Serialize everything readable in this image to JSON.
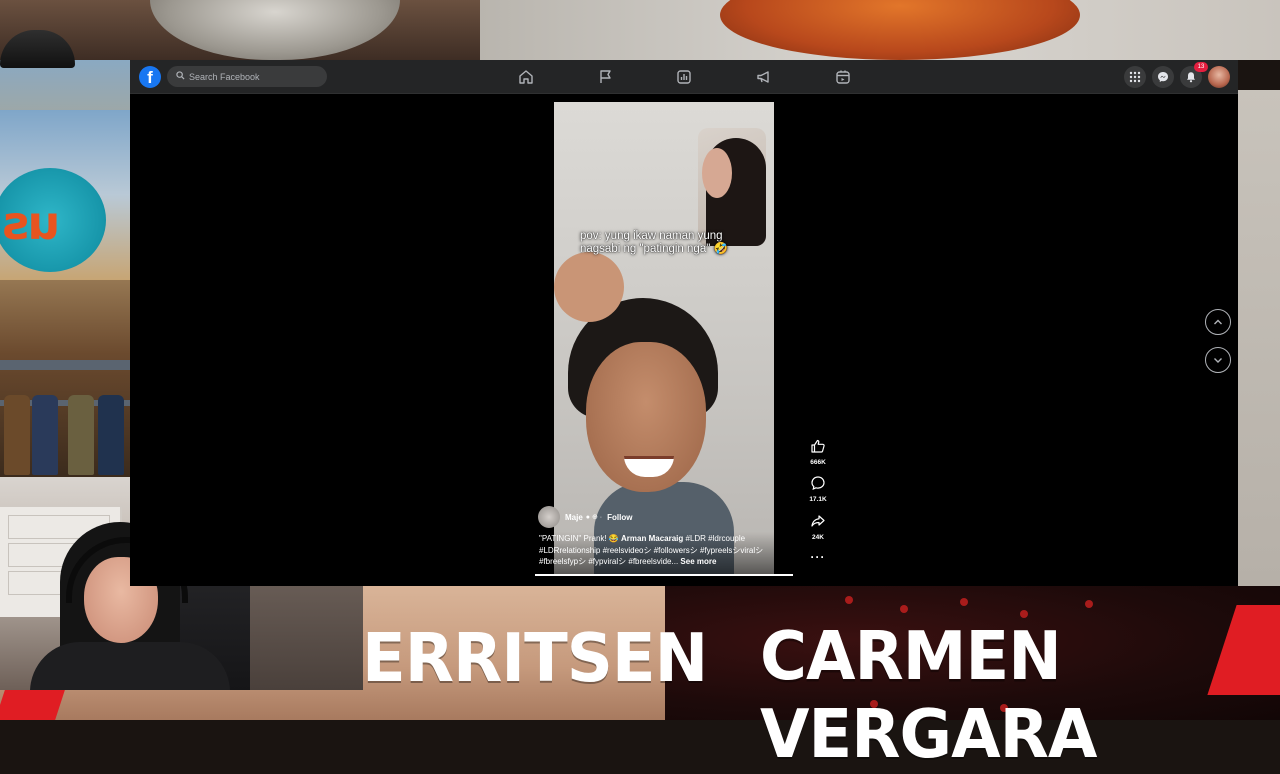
{
  "topbar": {
    "logo_glyph": "f",
    "search_placeholder": "Search Facebook",
    "nav_icons": [
      "home-icon",
      "flag-icon",
      "dashboard-icon",
      "megaphone-icon",
      "marketplace-icon"
    ],
    "right_icons": [
      "apps-grid-icon",
      "messenger-icon",
      "bell-icon"
    ],
    "notification_count": "13"
  },
  "reel": {
    "caption_line1": "pov: yung ikaw naman yung",
    "caption_line2": "nagsabi ng \"patingin nga\" 🤣",
    "author": "Maje",
    "follow_label": "Follow",
    "description_prefix": "\"PATINGIN\" Prank! 😂 ",
    "tagged_name": "Arman Macaraig",
    "description_rest": " #LDR #ldrcouple #LDRrelationship #reelsvideoシ #followersシ #fypreelsシviralシ #fbreelsfypシ #fypviralシ #fbreelsvide...",
    "see_more_label": "See more",
    "progress": 0.08
  },
  "actions": {
    "likes": "666K",
    "comments": "17.1K",
    "shares": "24K"
  },
  "overlay": {
    "name_left": "ERRITSEN",
    "name_right": "CARMEN VERGARA"
  },
  "colors": {
    "facebook_blue": "#1877f2",
    "topbar_bg": "#242526",
    "badge_red": "#e41e3f",
    "overlay_red": "#e01d23"
  }
}
